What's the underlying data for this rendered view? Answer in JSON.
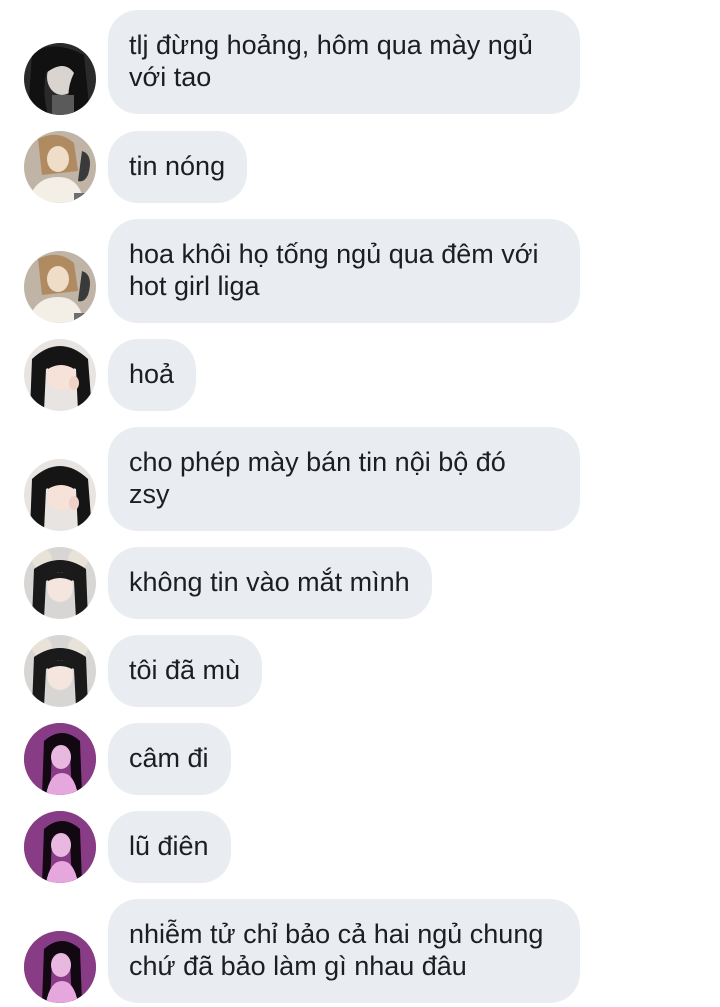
{
  "colors": {
    "background": "#ffffff",
    "bubble": "#e9edf1",
    "text": "#1c1e21"
  },
  "messages": [
    {
      "sender_avatar": "dark-hair-avatar-icon",
      "lines": [
        "tlj đừng hoảng, hôm qua mày ngủ",
        "với tao"
      ]
    },
    {
      "sender_avatar": "blonde-girl-avatar-icon",
      "lines": [
        "tin nóng"
      ]
    },
    {
      "sender_avatar": "blonde-girl-avatar-icon",
      "lines": [
        "hoa khôi họ tống ngủ qua đêm với",
        "hot girl liga"
      ]
    },
    {
      "sender_avatar": "black-hair-girl-avatar-icon",
      "lines": [
        "hoả"
      ]
    },
    {
      "sender_avatar": "black-hair-girl-avatar-icon",
      "lines": [
        "cho phép mày bán tin nội bộ đó",
        "zsy"
      ]
    },
    {
      "sender_avatar": "bear-ears-girl-avatar-icon",
      "lines": [
        "không tin vào mắt mình"
      ]
    },
    {
      "sender_avatar": "bear-ears-girl-avatar-icon",
      "lines": [
        "tôi đã mù"
      ]
    },
    {
      "sender_avatar": "purple-light-girl-avatar-icon",
      "lines": [
        "câm đi"
      ]
    },
    {
      "sender_avatar": "purple-light-girl-avatar-icon",
      "lines": [
        "lũ điên"
      ]
    },
    {
      "sender_avatar": "purple-light-girl-avatar-icon",
      "lines": [
        "nhiễm tử chỉ bảo cả hai ngủ chung",
        "chứ đã bảo làm gì nhau đâu"
      ]
    }
  ]
}
